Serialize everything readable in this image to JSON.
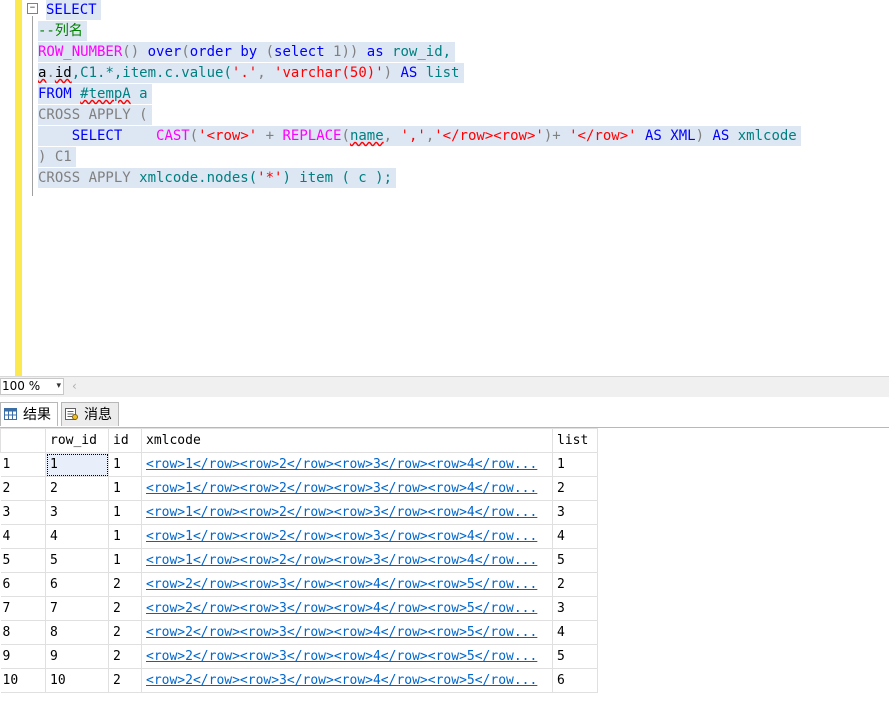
{
  "editor": {
    "collapse_glyph": "−",
    "lines": {
      "l1": {
        "a": "SELECT"
      },
      "l2": {
        "a": "--列名"
      },
      "l3": {
        "a": "ROW_NUMBER",
        "b": "() ",
        "c": "over",
        "d": "(",
        "e": "order by",
        "f": " (",
        "g": "select",
        "h": " 1)) ",
        "i": "as",
        "j": " row_id,"
      },
      "l4": {
        "a": "a",
        "b": ".",
        "c": "id",
        "d": ",C1.*,item.c.value(",
        "e": "'.'",
        "f": ", ",
        "g": "'varchar(50)'",
        "h": ") ",
        "i": "AS",
        "j": " list"
      },
      "l5": {
        "a": "FROM",
        "b": " ",
        "c": "#tempA",
        "d": " a"
      },
      "l6": {
        "a": "CROSS APPLY ("
      },
      "l7": {
        "a": "    ",
        "b": "SELECT",
        "c": "    ",
        "d": "CAST",
        "e": "(",
        "f": "'<row>'",
        "g": " + ",
        "h": "REPLACE",
        "i": "(",
        "j": "name",
        "k": ", ",
        "l": "','",
        "m": ",",
        "n": "'</row><row>'",
        "o": ")+ ",
        "p": "'</row>'",
        "q": " ",
        "r": "AS XML",
        "s": ") ",
        "t": "AS",
        "u": " xmlcode"
      },
      "l8": {
        "a": ") C1"
      },
      "l9": {
        "a": "CROSS APPLY",
        "b": " xmlcode.nodes(",
        "c": "'*'",
        "d": ") item ( c );"
      }
    }
  },
  "zoom": {
    "value": "100 %",
    "arrow": "▾",
    "scroll_left": "‹"
  },
  "tabs": {
    "results": "结果",
    "messages": "消息"
  },
  "grid": {
    "columns": [
      "",
      "row_id",
      "id",
      "xmlcode",
      "list"
    ],
    "rows": [
      [
        "1",
        "1",
        "1",
        "<row>1</row><row>2</row><row>3</row><row>4</row...",
        "1"
      ],
      [
        "2",
        "2",
        "1",
        "<row>1</row><row>2</row><row>3</row><row>4</row...",
        "2"
      ],
      [
        "3",
        "3",
        "1",
        "<row>1</row><row>2</row><row>3</row><row>4</row...",
        "3"
      ],
      [
        "4",
        "4",
        "1",
        "<row>1</row><row>2</row><row>3</row><row>4</row...",
        "4"
      ],
      [
        "5",
        "5",
        "1",
        "<row>1</row><row>2</row><row>3</row><row>4</row...",
        "5"
      ],
      [
        "6",
        "6",
        "2",
        "<row>2</row><row>3</row><row>4</row><row>5</row...",
        "2"
      ],
      [
        "7",
        "7",
        "2",
        "<row>2</row><row>3</row><row>4</row><row>5</row...",
        "3"
      ],
      [
        "8",
        "8",
        "2",
        "<row>2</row><row>3</row><row>4</row><row>5</row...",
        "4"
      ],
      [
        "9",
        "9",
        "2",
        "<row>2</row><row>3</row><row>4</row><row>5</row...",
        "5"
      ],
      [
        "10",
        "10",
        "2",
        "<row>2</row><row>3</row><row>4</row><row>5</row...",
        "6"
      ]
    ]
  }
}
